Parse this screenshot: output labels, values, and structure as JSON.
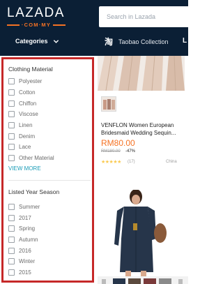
{
  "header": {
    "logo_word": "LAZADA",
    "logo_sub": "·COM·MY",
    "search_placeholder": "Search in Lazada",
    "categories_label": "Categories",
    "taobao_label": "Taobao Collection",
    "taobao_icon_glyph": "淘",
    "more_label": "L"
  },
  "filters": {
    "material": {
      "title": "Clothing Material",
      "options": [
        "Polyester",
        "Cotton",
        "Chiffon",
        "Viscose",
        "Linen",
        "Denim",
        "Lace",
        "Other Material"
      ],
      "view_more": "VIEW MORE"
    },
    "season": {
      "title": "Listed Year Season",
      "options": [
        "Summer",
        "2017",
        "Spring",
        "Autumn",
        "2016",
        "Winter",
        "2015"
      ]
    }
  },
  "product1": {
    "title": "VENFLON Women European Bridesmaid Wedding Sequin...",
    "price": "RM80.00",
    "original_price": "RM180.00",
    "discount": "-47%",
    "stars": "★★★★★",
    "reviews": "(17)",
    "origin": "China",
    "rating": 4.5
  },
  "colors": {
    "header_bg": "#0b1f35",
    "accent": "#f57224",
    "link": "#1a9cb7",
    "highlight_border": "#c62828"
  }
}
